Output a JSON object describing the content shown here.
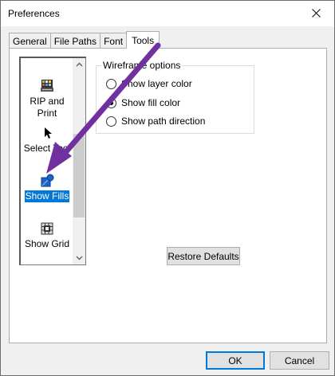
{
  "window": {
    "title": "Preferences"
  },
  "tabs": [
    {
      "label": "General"
    },
    {
      "label": "File Paths"
    },
    {
      "label": "Font"
    },
    {
      "label": "Tools"
    }
  ],
  "active_tab": "Tools",
  "tool_list": {
    "items": [
      {
        "label_line1": "RIP and",
        "label_line2": "Print",
        "icon": "rip-print-icon"
      },
      {
        "label_line1": "Select Tool",
        "label_line2": "",
        "icon": "cursor-arrow-icon"
      },
      {
        "label_line1": "Show Fills",
        "label_line2": "",
        "icon": "fill-shape-icon"
      },
      {
        "label_line1": "Show Grid",
        "label_line2": "",
        "icon": "grid-icon"
      }
    ],
    "selected": "Show Fills"
  },
  "wireframe": {
    "legend": "Wireframe options",
    "options": [
      {
        "label": "Show layer color",
        "checked": false
      },
      {
        "label": "Show fill color",
        "checked": true
      },
      {
        "label": "Show path direction",
        "checked": false
      }
    ]
  },
  "buttons": {
    "restore_defaults": "Restore Defaults",
    "ok": "OK",
    "cancel": "Cancel"
  },
  "colors": {
    "selection": "#0078d7",
    "annotation_arrow": "#7030a0"
  }
}
